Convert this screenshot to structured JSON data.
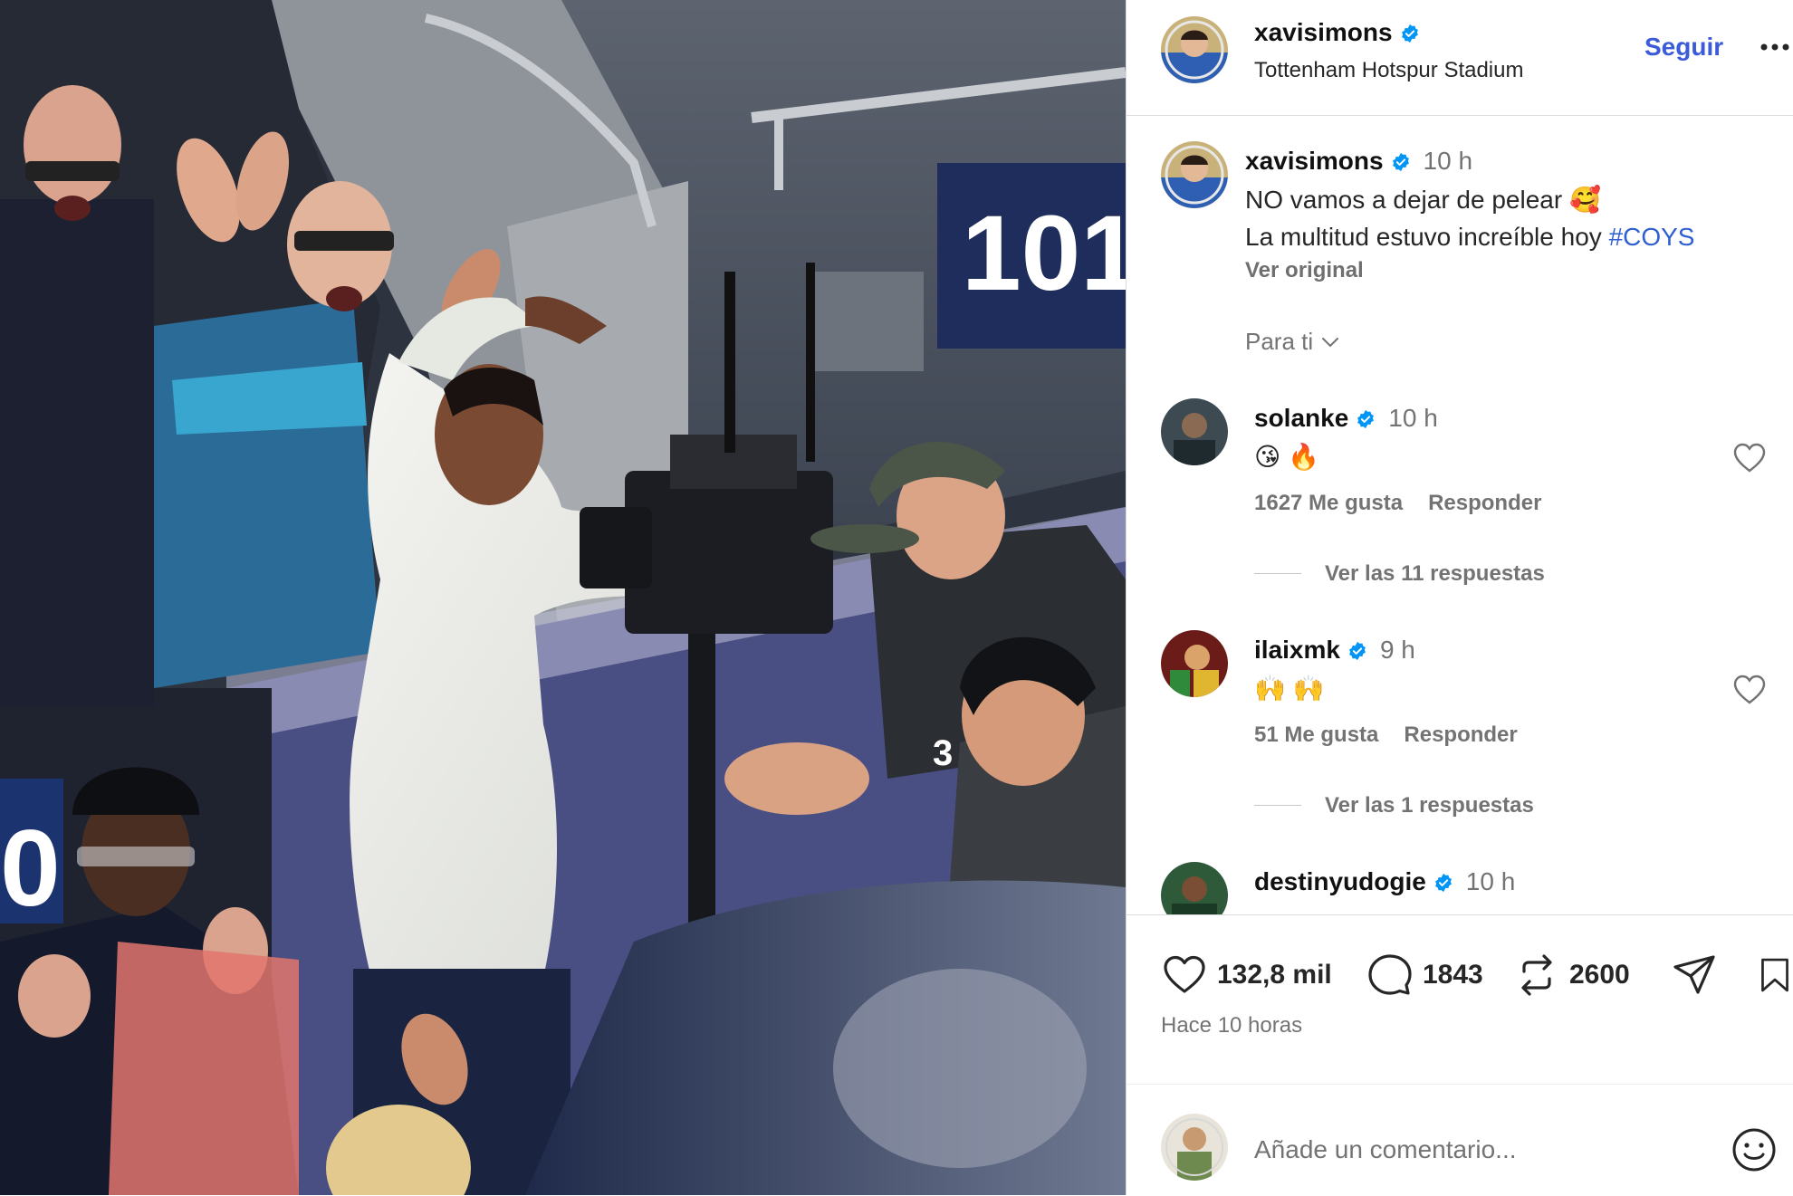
{
  "photo": {
    "stand_number": "101",
    "corner_number": "0",
    "vest_number": "3"
  },
  "post_header": {
    "username": "xavisimons",
    "location": "Tottenham Hotspur Stadium",
    "follow_label": "Seguir",
    "more_icon": "more-horizontal-icon",
    "verified_color": "#0095f6"
  },
  "caption": {
    "username": "xavisimons",
    "time": "10 h",
    "line1": "NO vamos a dejar de pelear 🥰",
    "line2_text": "La multitud estuvo increíble hoy ",
    "hashtag": "#COYS",
    "see_original": "Ver original"
  },
  "sort_menu": {
    "label": "Para ti",
    "icon": "chevron-down-icon"
  },
  "comments": [
    {
      "username": "solanke",
      "time": "10 h",
      "emoji": [
        "😘",
        "🔥"
      ],
      "likes": "1627 Me gusta",
      "reply_label": "Responder",
      "view_replies": "Ver las 11 respuestas"
    },
    {
      "username": "ilaixmk",
      "time": "9 h",
      "emoji": [
        "🙌",
        "🙌"
      ],
      "likes": "51 Me gusta",
      "reply_label": "Responder",
      "view_replies": "Ver las 1 respuestas"
    },
    {
      "username": "destinyudogie",
      "time": "10 h"
    }
  ],
  "actions": {
    "likes": "132,8 mil",
    "comments": "1843",
    "reposts": "2600",
    "posted": "Hace 10 horas"
  },
  "add_comment": {
    "placeholder": "Añade un comentario..."
  },
  "colors": {
    "link_blue": "#3b5bd9",
    "hashtag": "#2f5fd0",
    "muted": "#737373",
    "divider": "#dbdbdb"
  }
}
